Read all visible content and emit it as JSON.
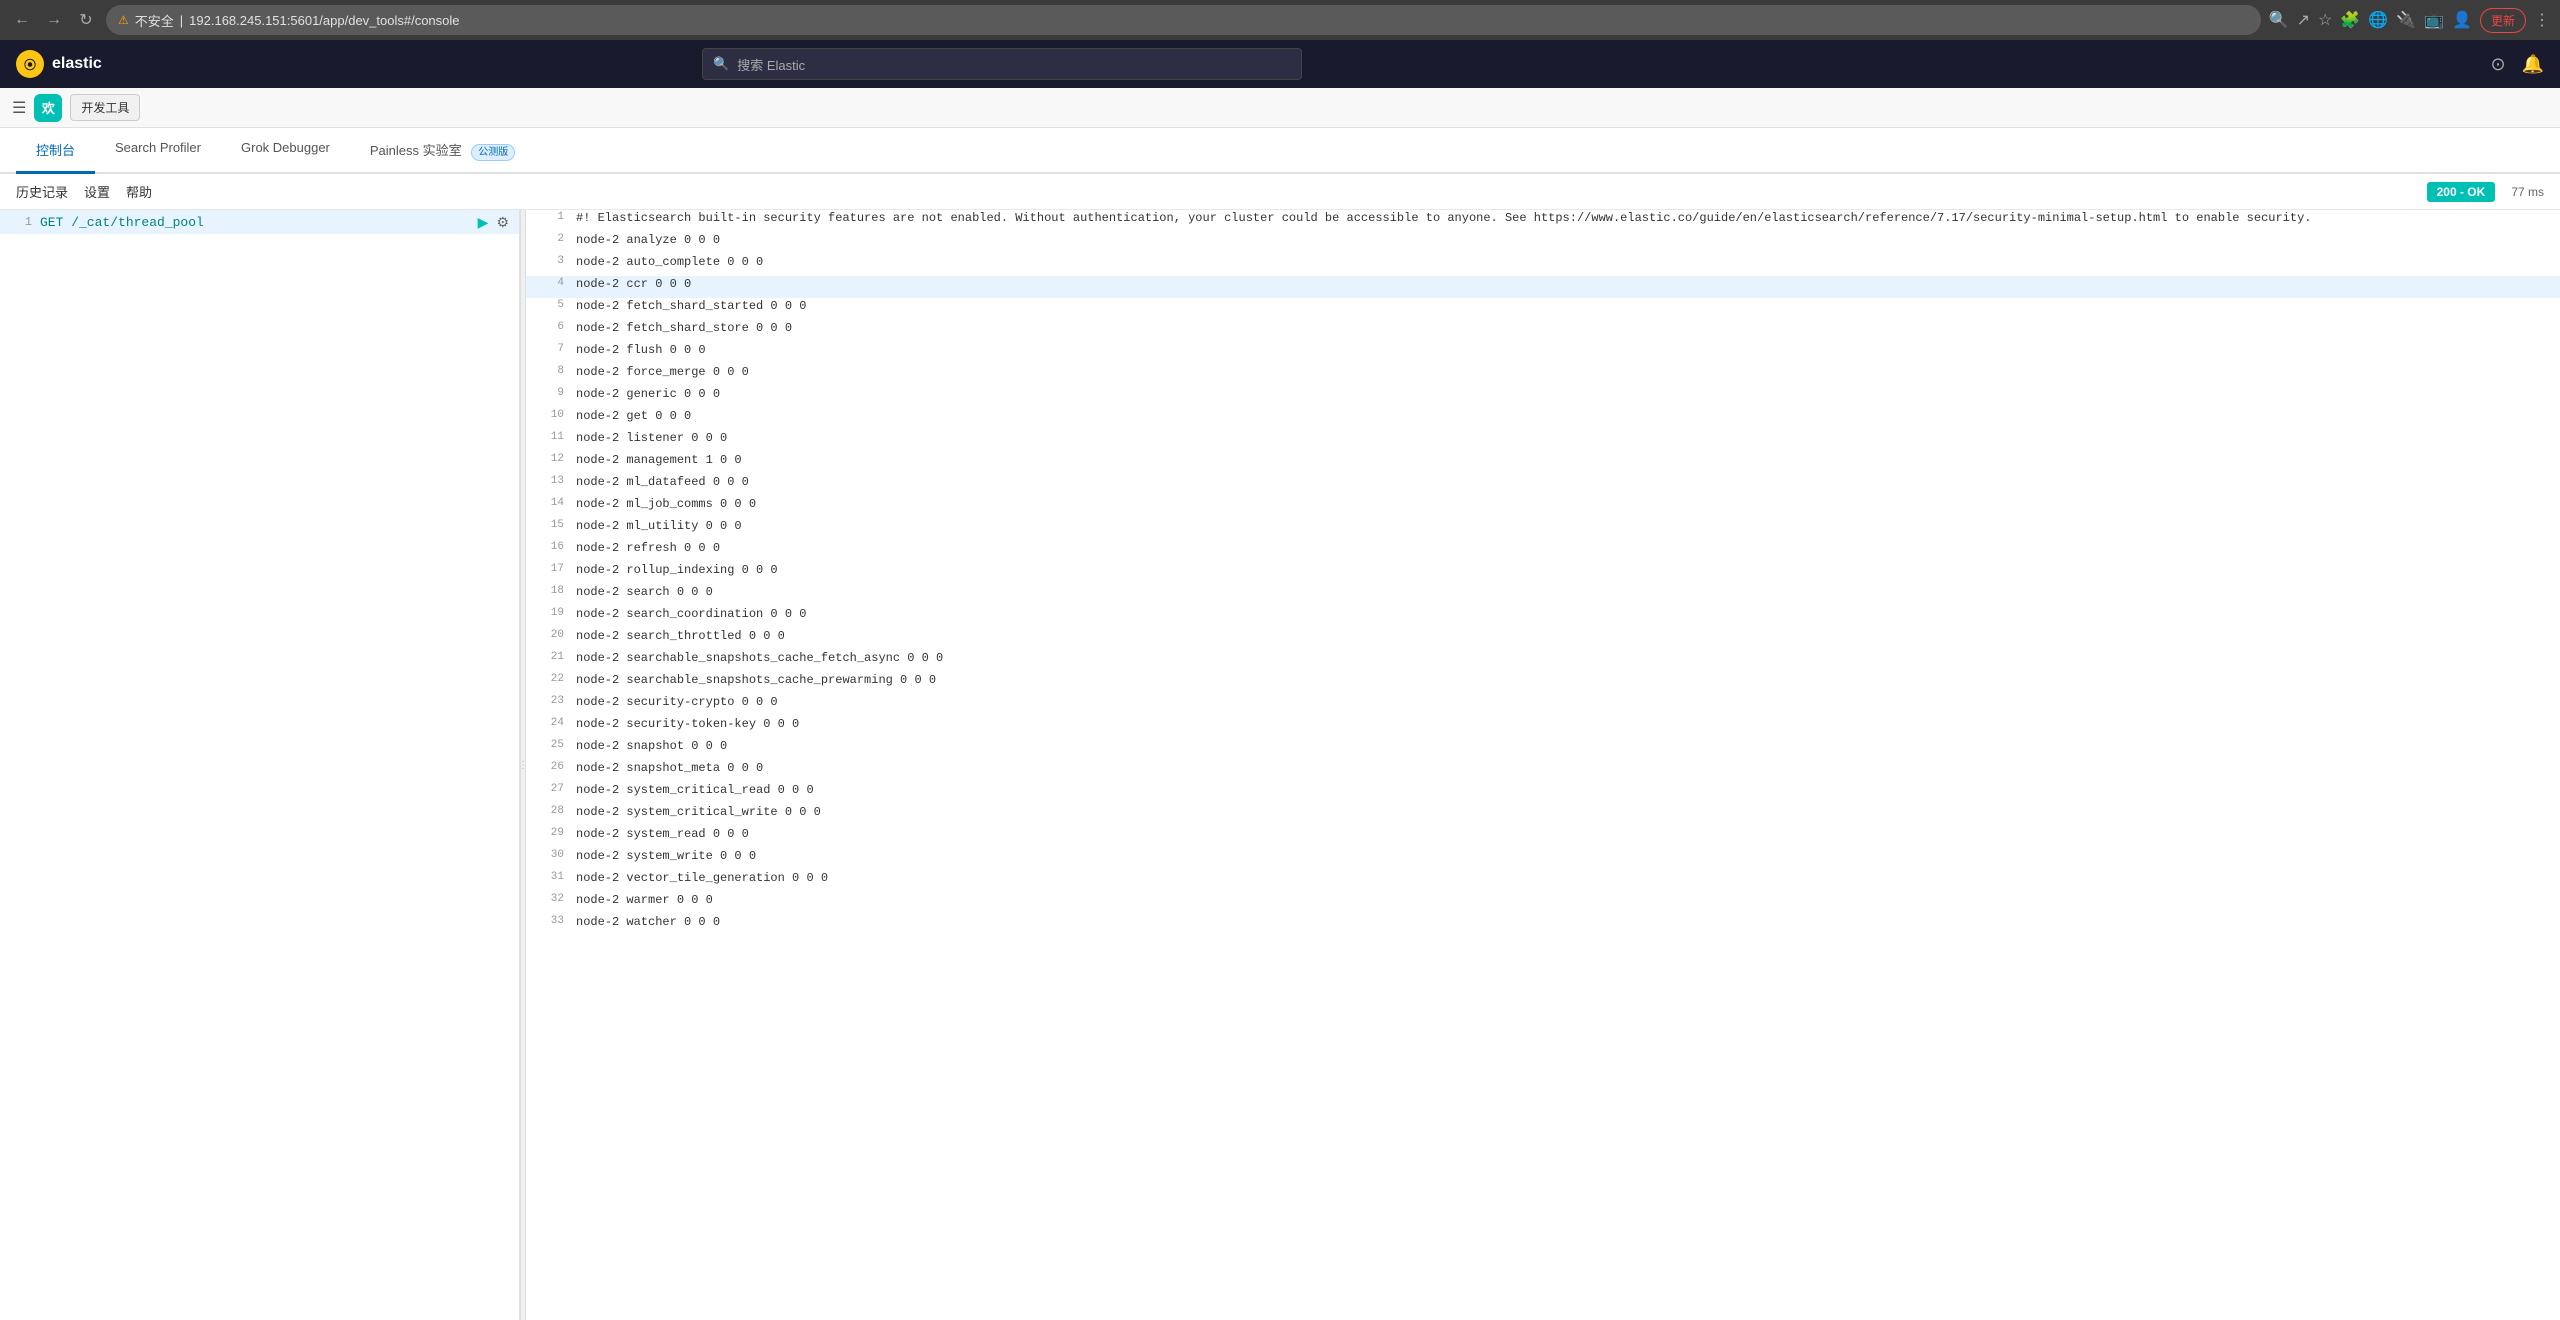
{
  "browser": {
    "url": "192.168.245.151:5601/app/dev_tools#/console",
    "url_prefix": "不安全",
    "update_btn": "更新"
  },
  "elastic": {
    "logo_text": "elastic",
    "logo_letter": "e",
    "search_placeholder": "搜索 Elastic"
  },
  "kibana": {
    "app_letter": "欢",
    "app_label": "开发工具"
  },
  "tabs": [
    {
      "id": "console",
      "label": "控制台",
      "active": true,
      "beta": false
    },
    {
      "id": "search-profiler",
      "label": "Search Profiler",
      "active": false,
      "beta": false
    },
    {
      "id": "grok-debugger",
      "label": "Grok Debugger",
      "active": false,
      "beta": false
    },
    {
      "id": "painless",
      "label": "Painless 实验室",
      "active": false,
      "beta": true,
      "beta_text": "公测版"
    }
  ],
  "toolbar": {
    "history": "历史记录",
    "settings": "设置",
    "help": "帮助",
    "status": "200 - OK",
    "timing": "77 ms"
  },
  "editor": {
    "line_num": "1",
    "command": "GET /_cat/thread_pool"
  },
  "output": {
    "lines": [
      {
        "num": 1,
        "content": "#! Elasticsearch built-in security features are not enabled. Without authentication, your cluster could be accessible to anyone. See https://www.elastic.co/guide/en/elasticsearch/reference/7.17/security-minimal-setup.html to enable security.",
        "highlighted": false
      },
      {
        "num": 2,
        "content": "node-2 analyze                   0 0 0",
        "highlighted": false
      },
      {
        "num": 3,
        "content": "node-2 auto_complete             0 0 0",
        "highlighted": false
      },
      {
        "num": 4,
        "content": "node-2 ccr                       0 0 0",
        "highlighted": true
      },
      {
        "num": 5,
        "content": "node-2 fetch_shard_started       0 0 0",
        "highlighted": false
      },
      {
        "num": 6,
        "content": "node-2 fetch_shard_store         0 0 0",
        "highlighted": false
      },
      {
        "num": 7,
        "content": "node-2 flush                     0 0 0",
        "highlighted": false
      },
      {
        "num": 8,
        "content": "node-2 force_merge               0 0 0",
        "highlighted": false
      },
      {
        "num": 9,
        "content": "node-2 generic                   0 0 0",
        "highlighted": false
      },
      {
        "num": 10,
        "content": "node-2 get                       0 0 0",
        "highlighted": false
      },
      {
        "num": 11,
        "content": "node-2 listener                  0 0 0",
        "highlighted": false
      },
      {
        "num": 12,
        "content": "node-2 management                1 0 0",
        "highlighted": false
      },
      {
        "num": 13,
        "content": "node-2 ml_datafeed               0 0 0",
        "highlighted": false
      },
      {
        "num": 14,
        "content": "node-2 ml_job_comms              0 0 0",
        "highlighted": false
      },
      {
        "num": 15,
        "content": "node-2 ml_utility                0 0 0",
        "highlighted": false
      },
      {
        "num": 16,
        "content": "node-2 refresh                   0 0 0",
        "highlighted": false
      },
      {
        "num": 17,
        "content": "node-2 rollup_indexing           0 0 0",
        "highlighted": false
      },
      {
        "num": 18,
        "content": "node-2 search                    0 0 0",
        "highlighted": false
      },
      {
        "num": 19,
        "content": "node-2 search_coordination       0 0 0",
        "highlighted": false
      },
      {
        "num": 20,
        "content": "node-2 search_throttled          0 0 0",
        "highlighted": false
      },
      {
        "num": 21,
        "content": "node-2 searchable_snapshots_cache_fetch_async 0 0 0",
        "highlighted": false
      },
      {
        "num": 22,
        "content": "node-2 searchable_snapshots_cache_prewarming 0 0 0",
        "highlighted": false
      },
      {
        "num": 23,
        "content": "node-2 security-crypto           0 0 0",
        "highlighted": false
      },
      {
        "num": 24,
        "content": "node-2 security-token-key        0 0 0",
        "highlighted": false
      },
      {
        "num": 25,
        "content": "node-2 snapshot                  0 0 0",
        "highlighted": false
      },
      {
        "num": 26,
        "content": "node-2 snapshot_meta             0 0 0",
        "highlighted": false
      },
      {
        "num": 27,
        "content": "node-2 system_critical_read      0 0 0",
        "highlighted": false
      },
      {
        "num": 28,
        "content": "node-2 system_critical_write     0 0 0",
        "highlighted": false
      },
      {
        "num": 29,
        "content": "node-2 system_read               0 0 0",
        "highlighted": false
      },
      {
        "num": 30,
        "content": "node-2 system_write              0 0 0",
        "highlighted": false
      },
      {
        "num": 31,
        "content": "node-2 vector_tile_generation    0 0 0",
        "highlighted": false
      },
      {
        "num": 32,
        "content": "node-2 warmer                    0 0 0",
        "highlighted": false
      },
      {
        "num": 33,
        "content": "node-2 watcher                   0 0 0",
        "highlighted": false
      }
    ]
  }
}
